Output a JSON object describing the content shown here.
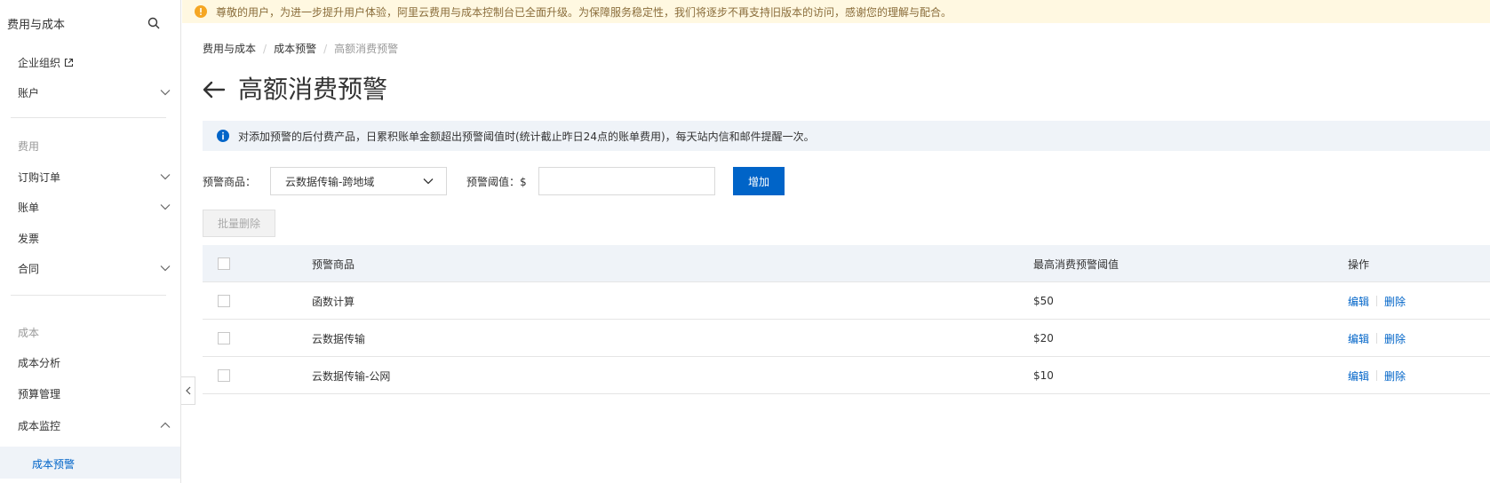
{
  "notice": {
    "text": "尊敬的用户，为进一步提升用户体验，阿里云费用与成本控制台已全面升级。为保障服务稳定性，我们将逐步不再支持旧版本的访问，感谢您的理解与配合。"
  },
  "sidebar": {
    "title": "费用与成本",
    "items": {
      "enterprise": "企业组织",
      "account": "账户",
      "group_fee": "费用",
      "orders": "订购订单",
      "bills": "账单",
      "invoice": "发票",
      "contract": "合同",
      "group_cost": "成本",
      "cost_analysis": "成本分析",
      "budget": "预算管理",
      "cost_monitor": "成本监控",
      "cost_alert": "成本预警"
    }
  },
  "breadcrumb": {
    "items": [
      "费用与成本",
      "成本预警",
      "高额消费预警"
    ],
    "separator": "/"
  },
  "page": {
    "title": "高额消费预警"
  },
  "info": {
    "text": "对添加预警的后付费产品，日累积账单金额超出预警阈值时(统计截止昨日24点的账单费用)，每天站内信和邮件提醒一次。"
  },
  "form": {
    "product_label": "预警商品：",
    "product_value": "云数据传输-跨地域",
    "threshold_label": "预警阈值：$",
    "threshold_value": "",
    "add_label": "增加",
    "batch_delete_label": "批量删除"
  },
  "table": {
    "headers": {
      "product": "预警商品",
      "threshold": "最高消费预警阈值",
      "actions": "操作"
    },
    "rows": [
      {
        "product": "函数计算",
        "threshold": "$50",
        "edit": "编辑",
        "delete": "删除"
      },
      {
        "product": "云数据传输",
        "threshold": "$20",
        "edit": "编辑",
        "delete": "删除"
      },
      {
        "product": "云数据传输-公网",
        "threshold": "$10",
        "edit": "编辑",
        "delete": "删除"
      }
    ]
  },
  "colors": {
    "primary": "#0064c8",
    "notice_bg": "#fff8e1",
    "info_bg": "#eff3f8",
    "warn": "#f5a623"
  },
  "icons": {
    "search": "search-icon",
    "external": "external-link-icon",
    "chevron_down": "chevron-down-icon",
    "chevron_up": "chevron-up-icon",
    "chevron_left": "chevron-left-icon",
    "back": "back-arrow-icon",
    "info": "info-icon",
    "warning": "warning-icon"
  }
}
